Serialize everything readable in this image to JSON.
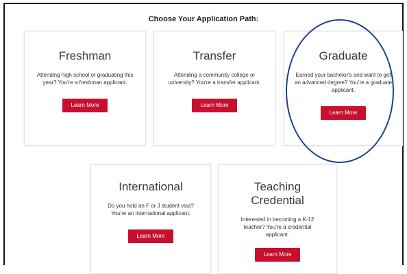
{
  "heading": "Choose Your Application Path:",
  "cards": [
    {
      "title": "Freshman",
      "description": "Attending high school or graduating this year? You're a freshman applicant.",
      "button": "Learn More"
    },
    {
      "title": "Transfer",
      "description": "Attending a community college or university? You're a transfer applicant.",
      "button": "Learn More"
    },
    {
      "title": "Graduate",
      "description": "Earned your bachelor's and want to get an advanced degree? You're a graduate applicant.",
      "button": "Learn More"
    },
    {
      "title": "International",
      "description": "Do you hold an F or J student visa? You're an international applicant.",
      "button": "Learn More"
    },
    {
      "title": "Teaching Credential",
      "description": "Interested in becoming a K-12 teacher? You're a credential applicant.",
      "button": "Learn More"
    }
  ],
  "colors": {
    "button_bg": "#c8102e",
    "circle": "#1f3f8f"
  }
}
